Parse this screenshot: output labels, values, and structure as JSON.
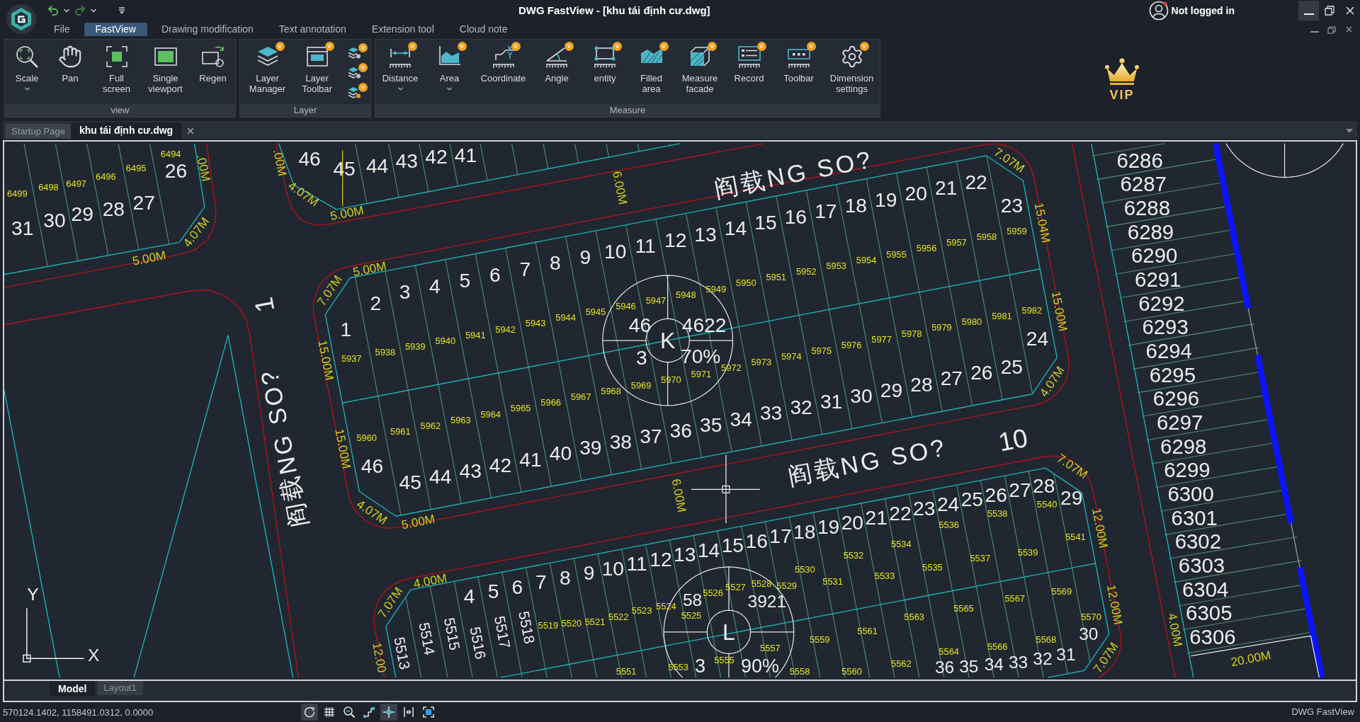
{
  "window": {
    "title": "DWG FastView - [khu tái định cư.dwg]",
    "account": "Not logged in"
  },
  "menu_tabs": [
    {
      "label": "File",
      "selected": false
    },
    {
      "label": "FastView",
      "selected": true
    },
    {
      "label": "Drawing modification",
      "selected": false
    },
    {
      "label": "Text annotation",
      "selected": false
    },
    {
      "label": "Extension tool",
      "selected": false
    },
    {
      "label": "Cloud note",
      "selected": false
    }
  ],
  "ribbon": {
    "groups": [
      {
        "label": "view",
        "tools": [
          {
            "label": "Scale",
            "dropdown": true
          },
          {
            "label": "Pan",
            "dropdown": false
          },
          {
            "label": "Full\nscreen",
            "dropdown": false
          },
          {
            "label": "Single\nviewport",
            "dropdown": false
          },
          {
            "label": "Regen",
            "dropdown": false
          }
        ]
      },
      {
        "label": "Layer",
        "tools": [
          {
            "label": "Layer\nManager",
            "dropdown": false,
            "badge": "v"
          },
          {
            "label": "Layer\nToolbar",
            "dropdown": false,
            "badge": "v"
          }
        ],
        "stack": [
          {
            "badge": "v"
          },
          {
            "badge": "v"
          },
          {
            "badge": "v"
          }
        ]
      },
      {
        "label": "Measure",
        "tools": [
          {
            "label": "Distance",
            "dropdown": true,
            "badge": "v"
          },
          {
            "label": "Area",
            "dropdown": true,
            "badge": "v"
          },
          {
            "label": "Coordinate",
            "dropdown": false,
            "badge": "v"
          },
          {
            "label": "Angle",
            "dropdown": false,
            "badge": "v"
          },
          {
            "label": "entity",
            "dropdown": false,
            "badge": "v"
          },
          {
            "label": "Filled\narea",
            "dropdown": false,
            "badge": "v"
          },
          {
            "label": "Measure\nfacade",
            "dropdown": false,
            "badge": "v"
          },
          {
            "label": "Record",
            "dropdown": false,
            "badge": "v"
          },
          {
            "label": "Toolbar",
            "dropdown": false,
            "badge": "v"
          },
          {
            "label": "Dimension\nsettings",
            "dropdown": false,
            "badge": "v"
          }
        ]
      }
    ],
    "vip": "VIP"
  },
  "document_tabs": [
    {
      "label": "Startup Page",
      "selected": false,
      "closable": false
    },
    {
      "label": "khu tái định cư.dwg",
      "selected": true,
      "closable": true
    }
  ],
  "drawing": {
    "roads": [
      {
        "label": "阎载NG SO?"
      },
      {
        "label": "阎载NG SO?",
        "number": "10"
      },
      {
        "label": "阎载NG SO?",
        "number": "1"
      }
    ],
    "road_widths": [
      "6.00M",
      "6.00M"
    ],
    "middle_block": {
      "lot_numbers": [
        "1",
        "2",
        "3",
        "4",
        "5",
        "6",
        "7",
        "8",
        "9",
        "10",
        "11",
        "12",
        "13",
        "14",
        "15",
        "16",
        "17",
        "18",
        "19",
        "20",
        "21",
        "22",
        "23",
        "46",
        "45",
        "44",
        "43",
        "42",
        "41",
        "40",
        "39",
        "38",
        "37",
        "36",
        "35",
        "34",
        "33",
        "32",
        "31",
        "30",
        "29",
        "28",
        "27",
        "26",
        "25",
        "24"
      ],
      "lot_codes": [
        "5937",
        "5938",
        "5939",
        "5940",
        "5941",
        "5942",
        "5943",
        "5944",
        "5945",
        "5946",
        "5947",
        "5948",
        "5949",
        "5950",
        "5951",
        "5952",
        "5953",
        "5954",
        "5955",
        "5956",
        "5957",
        "5958",
        "5959",
        "5960",
        "5961",
        "5962",
        "5963",
        "5964",
        "5965",
        "5966",
        "5967",
        "5968",
        "5969",
        "5970",
        "5971",
        "5972",
        "5973",
        "5974",
        "5975",
        "5976",
        "5977",
        "5978",
        "5979",
        "5980",
        "5981",
        "5982"
      ],
      "edge_dimensions": [
        "7.07M",
        "5.00M",
        "15.00M",
        "15.00M",
        "4.07M",
        "5.00M",
        "7.07M",
        "15.04M",
        "15.00M",
        "4.07M"
      ],
      "symbol": {
        "letter": "K",
        "labels": [
          "46",
          "4622",
          "3",
          "70%"
        ]
      }
    },
    "lower_block": {
      "lot_numbers": [
        "4",
        "5",
        "6",
        "7",
        "8",
        "9",
        "10",
        "11",
        "12",
        "13",
        "14",
        "15",
        "16",
        "17",
        "18",
        "19",
        "20",
        "21",
        "22",
        "23",
        "24",
        "25",
        "26",
        "27",
        "28",
        "29",
        "36",
        "35",
        "34",
        "33",
        "32",
        "31",
        "30"
      ],
      "rotated_codes": [
        "5513",
        "5514",
        "5515",
        "5516",
        "5517",
        "5518"
      ],
      "lot_codes": [
        "5519",
        "5520",
        "5521",
        "5522",
        "5523",
        "5524",
        "5525",
        "5526",
        "5527",
        "5528",
        "5529",
        "5530",
        "5531",
        "5532",
        "5533",
        "5534",
        "5535",
        "5536",
        "5537",
        "5538",
        "5539",
        "5540",
        "5541",
        "5551",
        "5553",
        "5555",
        "5557",
        "5558",
        "5559",
        "5560",
        "5561",
        "5562",
        "5563",
        "5564",
        "5565",
        "5566",
        "5567",
        "5568",
        "5569",
        "5570"
      ],
      "edge_dimensions": [
        "4.00M",
        "7.07M",
        "12.00",
        "7.07M",
        "12.00M",
        "12.00M",
        "7.07M"
      ],
      "symbol": {
        "letter": "L",
        "labels": [
          "58",
          "3921",
          "3",
          "90%"
        ]
      }
    },
    "upper_left_block": {
      "lot_numbers": [
        "31",
        "30",
        "29",
        "28",
        "27",
        "26"
      ],
      "lot_codes": [
        "6499",
        "6498",
        "6497",
        "6496",
        "6495",
        "6494"
      ],
      "edge_dimensions": [
        "5.00M",
        "4.07M",
        ".00M"
      ]
    },
    "upper_block": {
      "lot_numbers": [
        "46",
        "45",
        "44",
        "43",
        "42",
        "41"
      ],
      "edge_dimensions": [
        "4.07M",
        "5.00M",
        ".00M"
      ]
    },
    "right_column": {
      "lot_numbers": [
        "6286",
        "6287",
        "6288",
        "6289",
        "6290",
        "6291",
        "6292",
        "6293",
        "6294",
        "6295",
        "6296",
        "6297",
        "6298",
        "6299",
        "6300",
        "6301",
        "6302",
        "6303",
        "6304",
        "6305",
        "6306"
      ],
      "edge_dimensions": [
        "4.00M",
        "20.00M"
      ]
    },
    "axes": {
      "x": "X",
      "y": "Y"
    }
  },
  "layout_tabs": [
    {
      "label": "Model",
      "selected": true
    },
    {
      "label": "Layout1",
      "selected": false
    }
  ],
  "status_bar": {
    "coordinates": "570124.1402, 1158491.0312, 0.0000",
    "toggles": [
      {
        "on": true
      },
      {
        "on": false
      },
      {
        "on": false
      },
      {
        "on": false
      },
      {
        "on": true
      },
      {
        "on": false
      },
      {
        "on": false
      }
    ],
    "product": "DWG FastView"
  }
}
